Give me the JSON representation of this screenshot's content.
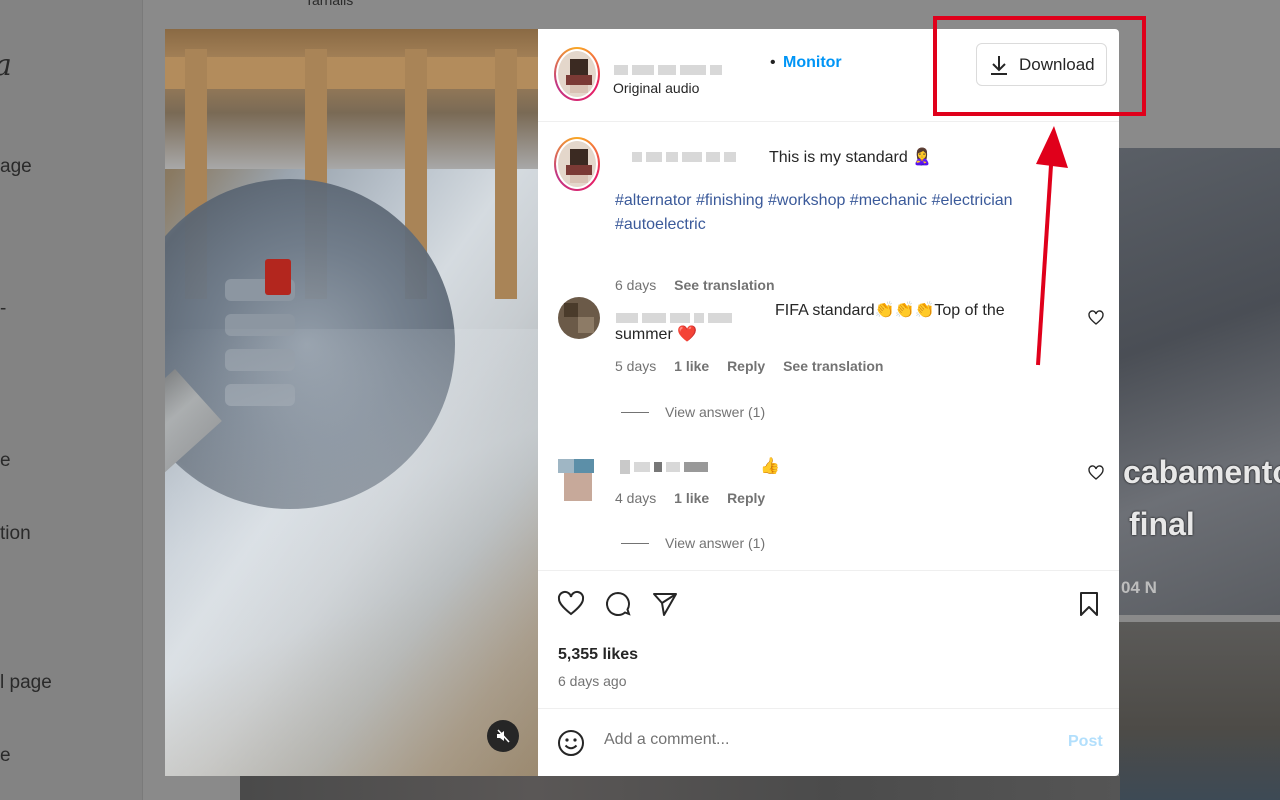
{
  "background": {
    "logo_text": "a",
    "sidebar_items": [
      "age",
      "-",
      "e",
      "tion",
      "l page",
      "e"
    ],
    "top_text": "Tarhalis",
    "tile_overlay_line1": "cabamento",
    "tile_overlay_line2": "final",
    "tile_stat": "04 N"
  },
  "post": {
    "author_link": "Monitor",
    "separator": "•",
    "audio_label": "Original audio",
    "download_label": "Download",
    "caption": "This is my standard 🙎‍♀️",
    "hashtags": "#alternator #finishing #workshop #mechanic #electrician #autoelectric",
    "caption_age": "6 days",
    "see_translation": "See translation",
    "likes": "5,355 likes",
    "posted_ago": "6 days ago"
  },
  "comments": [
    {
      "text": "FIFA standard👏👏👏Top of the summer ❤️",
      "age": "5 days",
      "likes": "1 like",
      "reply": "Reply",
      "see_translation": "See translation",
      "view_answers": "View answer (1)"
    },
    {
      "text": "👍",
      "age": "4 days",
      "likes": "1 like",
      "reply": "Reply",
      "view_answers": "View answer (1)"
    }
  ],
  "composer": {
    "placeholder": "Add a comment...",
    "post_label": "Post"
  },
  "colors": {
    "accent": "#0095f6",
    "hashtag": "#3b5a9a",
    "annotation_red": "#e0001b"
  }
}
